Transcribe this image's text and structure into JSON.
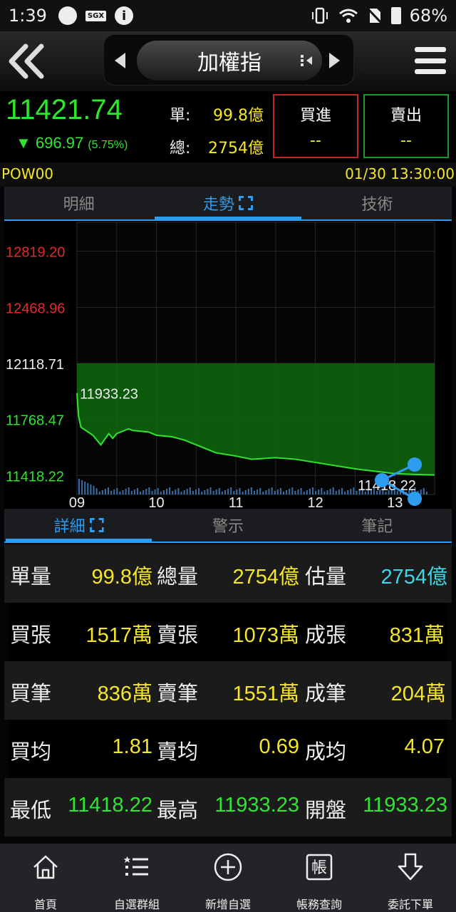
{
  "status_bar": {
    "time": "1:39",
    "sgx_badge": "SGX",
    "info_glyph": "i",
    "battery_pct": "68%"
  },
  "header": {
    "title": "加權指"
  },
  "quote": {
    "price": "11421.74",
    "change_arrow": "▼",
    "change": "696.97",
    "change_pct": "(5.75%)",
    "single_label": "單:",
    "single_value": "99.8億",
    "total_label": "總:",
    "total_value": "2754億",
    "buy_label": "買進",
    "buy_value": "--",
    "sell_label": "賣出",
    "sell_value": "--"
  },
  "info_row": {
    "code": "POW00",
    "datetime": "01/30 13:30:00"
  },
  "chart_tabs": [
    {
      "label": "明細"
    },
    {
      "label": "走勢"
    },
    {
      "label": "技術"
    }
  ],
  "chart_data": {
    "type": "area",
    "y_ticks": [
      "12819.20",
      "12468.96",
      "12118.71",
      "11768.47",
      "11418.22"
    ],
    "y_tick_colors": [
      "#e62828",
      "#e62828",
      "#eeeeee",
      "#2ee62e",
      "#2ee62e"
    ],
    "x_ticks": [
      "09",
      "10",
      "11",
      "12",
      "13"
    ],
    "reference": 12118.71,
    "ylim": [
      11300,
      13000
    ],
    "annotation_high": "11933.23",
    "annotation_low": "11418.22",
    "x": [
      0,
      0.02,
      0.05,
      0.2,
      0.3,
      0.4,
      0.45,
      0.5,
      0.6,
      0.65,
      0.7,
      0.9,
      1.0,
      1.2,
      1.35,
      1.5,
      1.75,
      2.0,
      2.2,
      2.5,
      2.75,
      3.0,
      3.25,
      3.5,
      3.75,
      4.0,
      4.25,
      4.5
    ],
    "y": [
      11933.23,
      11790,
      11720,
      11670,
      11610,
      11680,
      11650,
      11680,
      11700,
      11710,
      11700,
      11690,
      11670,
      11660,
      11640,
      11610,
      11560,
      11540,
      11520,
      11530,
      11520,
      11500,
      11480,
      11460,
      11445,
      11430,
      11425,
      11421.74
    ],
    "line_color": "#2ee62e",
    "fill_color": "#0f6a0f",
    "grid": true
  },
  "detail_tabs": [
    {
      "label": "詳細"
    },
    {
      "label": "警示"
    },
    {
      "label": "筆記"
    }
  ],
  "stats": [
    {
      "cells": [
        {
          "label": "單量",
          "value": "99.8億",
          "color": "yellow"
        },
        {
          "label": "總量",
          "value": "2754億",
          "color": "yellow"
        },
        {
          "label": "估量",
          "value": "2754億",
          "color": "cyan"
        }
      ]
    },
    {
      "cells": [
        {
          "label": "買張",
          "value": "1517萬",
          "color": "yellow"
        },
        {
          "label": "賣張",
          "value": "1073萬",
          "color": "yellow"
        },
        {
          "label": "成張",
          "value": "831萬",
          "color": "yellow"
        }
      ]
    },
    {
      "cells": [
        {
          "label": "買筆",
          "value": "836萬",
          "color": "yellow"
        },
        {
          "label": "賣筆",
          "value": "1551萬",
          "color": "yellow"
        },
        {
          "label": "成筆",
          "value": "204萬",
          "color": "yellow"
        }
      ]
    },
    {
      "cells": [
        {
          "label": "買均",
          "value": "1.81",
          "color": "yellow"
        },
        {
          "label": "賣均",
          "value": "0.69",
          "color": "yellow"
        },
        {
          "label": "成均",
          "value": "4.07",
          "color": "yellow"
        }
      ]
    },
    {
      "cells": [
        {
          "label": "最低",
          "value": "11418.22",
          "color": "green"
        },
        {
          "label": "最高",
          "value": "11933.23",
          "color": "green"
        },
        {
          "label": "開盤",
          "value": "11933.23",
          "color": "green"
        }
      ]
    }
  ],
  "bottom_nav": [
    {
      "label": "首頁",
      "icon": "home-icon"
    },
    {
      "label": "自選群組",
      "icon": "list-icon"
    },
    {
      "label": "新增自選",
      "icon": "plus-circle-icon"
    },
    {
      "label": "帳務查詢",
      "icon": "account-icon"
    },
    {
      "label": "委託下單",
      "icon": "order-icon"
    }
  ]
}
